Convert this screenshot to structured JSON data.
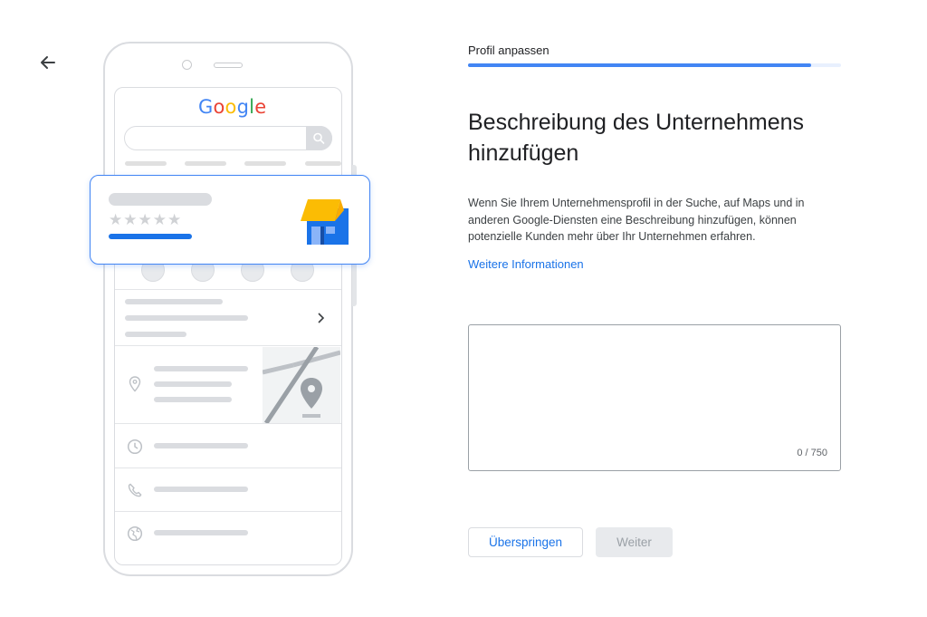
{
  "back_button": {
    "icon": "arrow-back-icon"
  },
  "illustration": {
    "logo_letters": [
      {
        "char": "G",
        "color": "#4285f4"
      },
      {
        "char": "o",
        "color": "#ea4335"
      },
      {
        "char": "o",
        "color": "#fbbc05"
      },
      {
        "char": "g",
        "color": "#4285f4"
      },
      {
        "char": "l",
        "color": "#34a853"
      },
      {
        "char": "e",
        "color": "#ea4335"
      }
    ],
    "card": {
      "stars": "★★★★★",
      "store_icon": "storefront-icon",
      "awning_color": "#fbbc04",
      "store_color": "#1a73e8"
    }
  },
  "step": {
    "label": "Profil anpassen",
    "progress": 0.92
  },
  "main": {
    "heading": "Beschreibung des Unternehmens hinzufügen",
    "description": "Wenn Sie Ihrem Unternehmensprofil in der Suche, auf Maps und in anderen Google-Diensten eine Beschreibung hinzufügen, können potenzielle Kunden mehr über Ihr Unternehmen erfahren.",
    "more_link": "Weitere Informationen",
    "textarea_value": "",
    "counter": "0 / 750"
  },
  "buttons": {
    "skip": "Überspringen",
    "next": "Weiter"
  },
  "colors": {
    "accent": "#1a73e8",
    "progress": "#4285f4",
    "disabled_bg": "#e8eaed",
    "disabled_text": "#9aa0a6"
  }
}
